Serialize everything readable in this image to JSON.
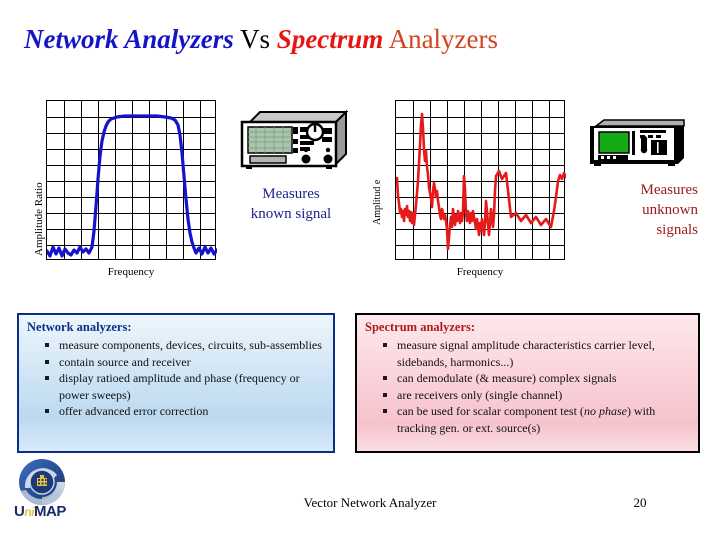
{
  "title": {
    "part1": "Network  Analyzers",
    "part2": " Vs ",
    "part3": "Spectrum",
    "part4": " Analyzers"
  },
  "left": {
    "chart": {
      "ylabel": "Amplitude Ratio",
      "xlabel": "Frequency",
      "trace_color": "#1414cd",
      "grid_color": "#000000",
      "cols": 10,
      "rows": 10
    },
    "instrument": "network-analyzer",
    "caption_line1": "Measures",
    "caption_line2": "known signal",
    "caption_color": "#1f1f8c",
    "box": {
      "heading": "Network analyzers:",
      "heading_color": "#0a2f8a",
      "items": [
        "measure components, devices, circuits, sub-assemblies",
        "contain source and receiver",
        "display ratioed amplitude and phase (frequency or power sweeps)",
        "offer advanced error correction"
      ]
    }
  },
  "right": {
    "chart": {
      "ylabel": "Amplitud e",
      "xlabel": "Frequency",
      "trace_color": "#e51b1b",
      "grid_color": "#000000",
      "cols": 10,
      "rows": 10
    },
    "instrument": "spectrum-analyzer",
    "caption_line1": "Measures",
    "caption_line2": "unknown",
    "caption_line3": "signals",
    "caption_color": "#9c1a1a",
    "box": {
      "heading": "Spectrum analyzers:",
      "heading_color": "#b01a1a",
      "items": [
        "measure signal amplitude characteristics carrier level, sidebands, harmonics...)",
        "can demodulate (& measure) complex signals",
        "are receivers only (single channel)",
        "can be used for scalar component test (no phase) with tracking gen. or ext. source(s)"
      ],
      "item4_pre": "can be used for scalar component test (",
      "item4_ital1": "no",
      "item4_mid": "",
      "item4_ital2": "phase",
      "item4_post": ") with tracking gen. or ext. source(s)"
    }
  },
  "footer": {
    "title": "Vector Network Analyzer",
    "page_number": "20"
  },
  "logo": {
    "u": "U",
    "ni": "ni",
    "map": "MAP"
  },
  "chart_data": [
    {
      "type": "line",
      "name": "network-analyzer-response",
      "title": "",
      "xlabel": "Frequency",
      "ylabel": "Amplitude Ratio",
      "xlim": [
        0,
        100
      ],
      "ylim": [
        0,
        100
      ],
      "grid": true,
      "series": [
        {
          "name": "bandpass filter response",
          "color": "#1414cd",
          "x": [
            0,
            2,
            4,
            6,
            8,
            10,
            12,
            14,
            16,
            18,
            20,
            21,
            22,
            23,
            24,
            25,
            26,
            27,
            28,
            30,
            33,
            36,
            40,
            45,
            50,
            55,
            60,
            65,
            70,
            73,
            75,
            76,
            77,
            78,
            79,
            80,
            81,
            82,
            84,
            86,
            88,
            90,
            92,
            94,
            96,
            98,
            100
          ],
          "y": [
            6,
            3,
            9,
            4,
            8,
            3,
            7,
            5,
            4,
            6,
            5,
            12,
            30,
            55,
            75,
            85,
            89,
            90,
            91,
            91,
            91,
            91,
            91,
            92,
            92,
            91,
            91,
            91,
            91,
            90,
            88,
            80,
            62,
            40,
            22,
            12,
            6,
            4,
            9,
            3,
            8,
            4,
            9,
            3,
            8,
            5,
            6
          ]
        }
      ]
    },
    {
      "type": "line",
      "name": "spectrum-analyzer-trace",
      "title": "",
      "xlabel": "Frequency",
      "ylabel": "Amplitude",
      "xlim": [
        0,
        100
      ],
      "ylim": [
        0,
        100
      ],
      "grid": true,
      "series": [
        {
          "name": "noisy spectrum with carrier peak",
          "color": "#e51b1b",
          "x": [
            0,
            1,
            2,
            3,
            4,
            5,
            6,
            7,
            8,
            9,
            10,
            11,
            12,
            13,
            14,
            15,
            16,
            17,
            18,
            19,
            20,
            21,
            22,
            23,
            24,
            25,
            26,
            27,
            28,
            29,
            30,
            31,
            32,
            33,
            34,
            35,
            36,
            37,
            38,
            39,
            40,
            41,
            42,
            43,
            44,
            45,
            46,
            47,
            48,
            49,
            50,
            51,
            52,
            53,
            54,
            55,
            56,
            57,
            58,
            59,
            60,
            61,
            62,
            63,
            64,
            65,
            66,
            67,
            68,
            69,
            70,
            71,
            72,
            73,
            74,
            75,
            76,
            77,
            78,
            79,
            80,
            81,
            82,
            83,
            84,
            85,
            86,
            87,
            88,
            89,
            90,
            91,
            92,
            93,
            94,
            95,
            96,
            97,
            98,
            99,
            100
          ],
          "y": [
            48,
            36,
            30,
            22,
            26,
            20,
            24,
            18,
            26,
            22,
            28,
            20,
            24,
            18,
            23,
            16,
            22,
            14,
            20,
            26,
            34,
            44,
            58,
            72,
            86,
            92,
            82,
            68,
            60,
            66,
            56,
            50,
            42,
            38,
            34,
            30,
            40,
            46,
            42,
            36,
            40,
            34,
            30,
            26,
            24,
            30,
            28,
            24,
            26,
            22,
            18,
            8,
            14,
            20,
            24,
            18,
            28,
            22,
            18,
            24,
            20,
            26,
            22,
            18,
            24,
            20,
            26,
            44,
            34,
            24,
            20,
            26,
            22,
            18,
            24,
            20,
            26,
            22,
            18,
            14,
            20,
            16,
            12,
            18,
            14,
            20,
            16,
            12,
            18,
            26,
            22,
            16,
            12,
            18,
            24,
            20,
            16,
            22,
            30,
            44,
            48
          ]
        }
      ]
    }
  ]
}
